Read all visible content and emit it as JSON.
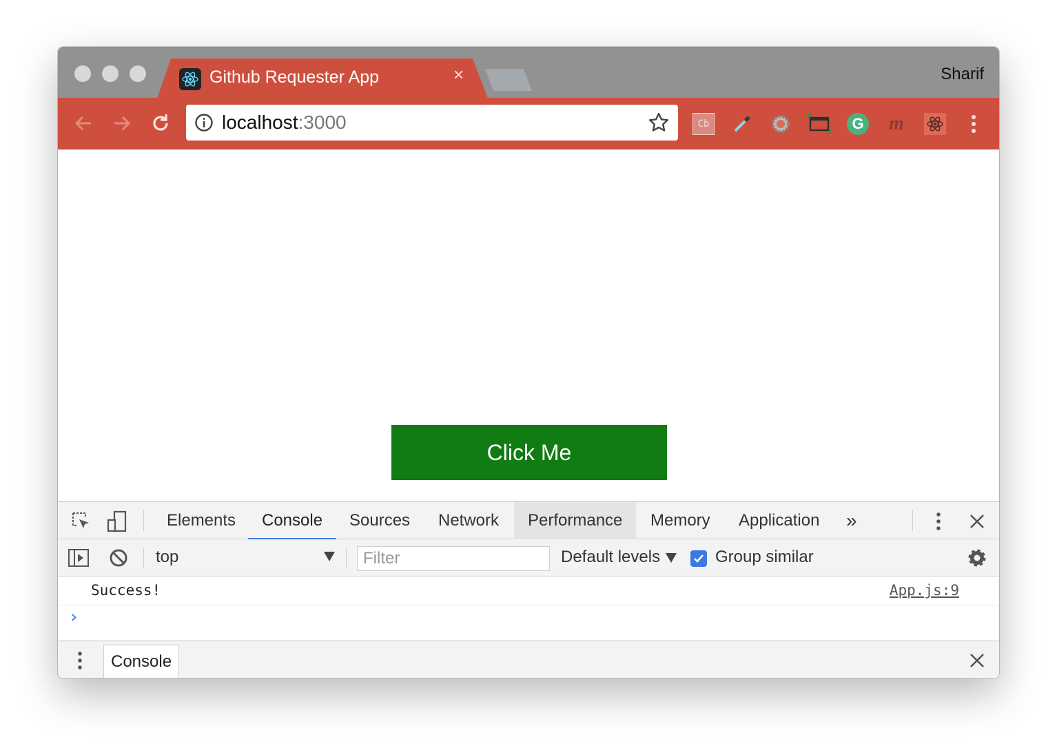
{
  "browser": {
    "tab": {
      "title": "Github Requester App",
      "favicon": "react-logo-icon",
      "close": "×"
    },
    "profile_name": "Sharif",
    "address": {
      "host": "localhost",
      "port": ":3000"
    },
    "extensions": [
      "cb-icon",
      "eyedropper-icon",
      "gear-extension-icon",
      "window-resizer-icon",
      "grammarly-icon",
      "m-extension-icon",
      "react-devtools-icon",
      "menu-dots-icon"
    ],
    "accent_color": "#cf4f3e"
  },
  "page": {
    "button_label": "Click Me",
    "button_color": "#107c13"
  },
  "devtools": {
    "tabs": [
      "Elements",
      "Console",
      "Sources",
      "Network",
      "Performance",
      "Memory",
      "Application"
    ],
    "selected_tab": "Console",
    "more_tabs": "»",
    "console_toolbar": {
      "context": "top",
      "filter_placeholder": "Filter",
      "levels": "Default levels",
      "group_similar_label": "Group similar",
      "group_similar_checked": true
    },
    "messages": [
      {
        "text": "Success!",
        "source": "App.js:9"
      }
    ],
    "prompt": "›",
    "drawer": {
      "tab": "Console"
    }
  }
}
